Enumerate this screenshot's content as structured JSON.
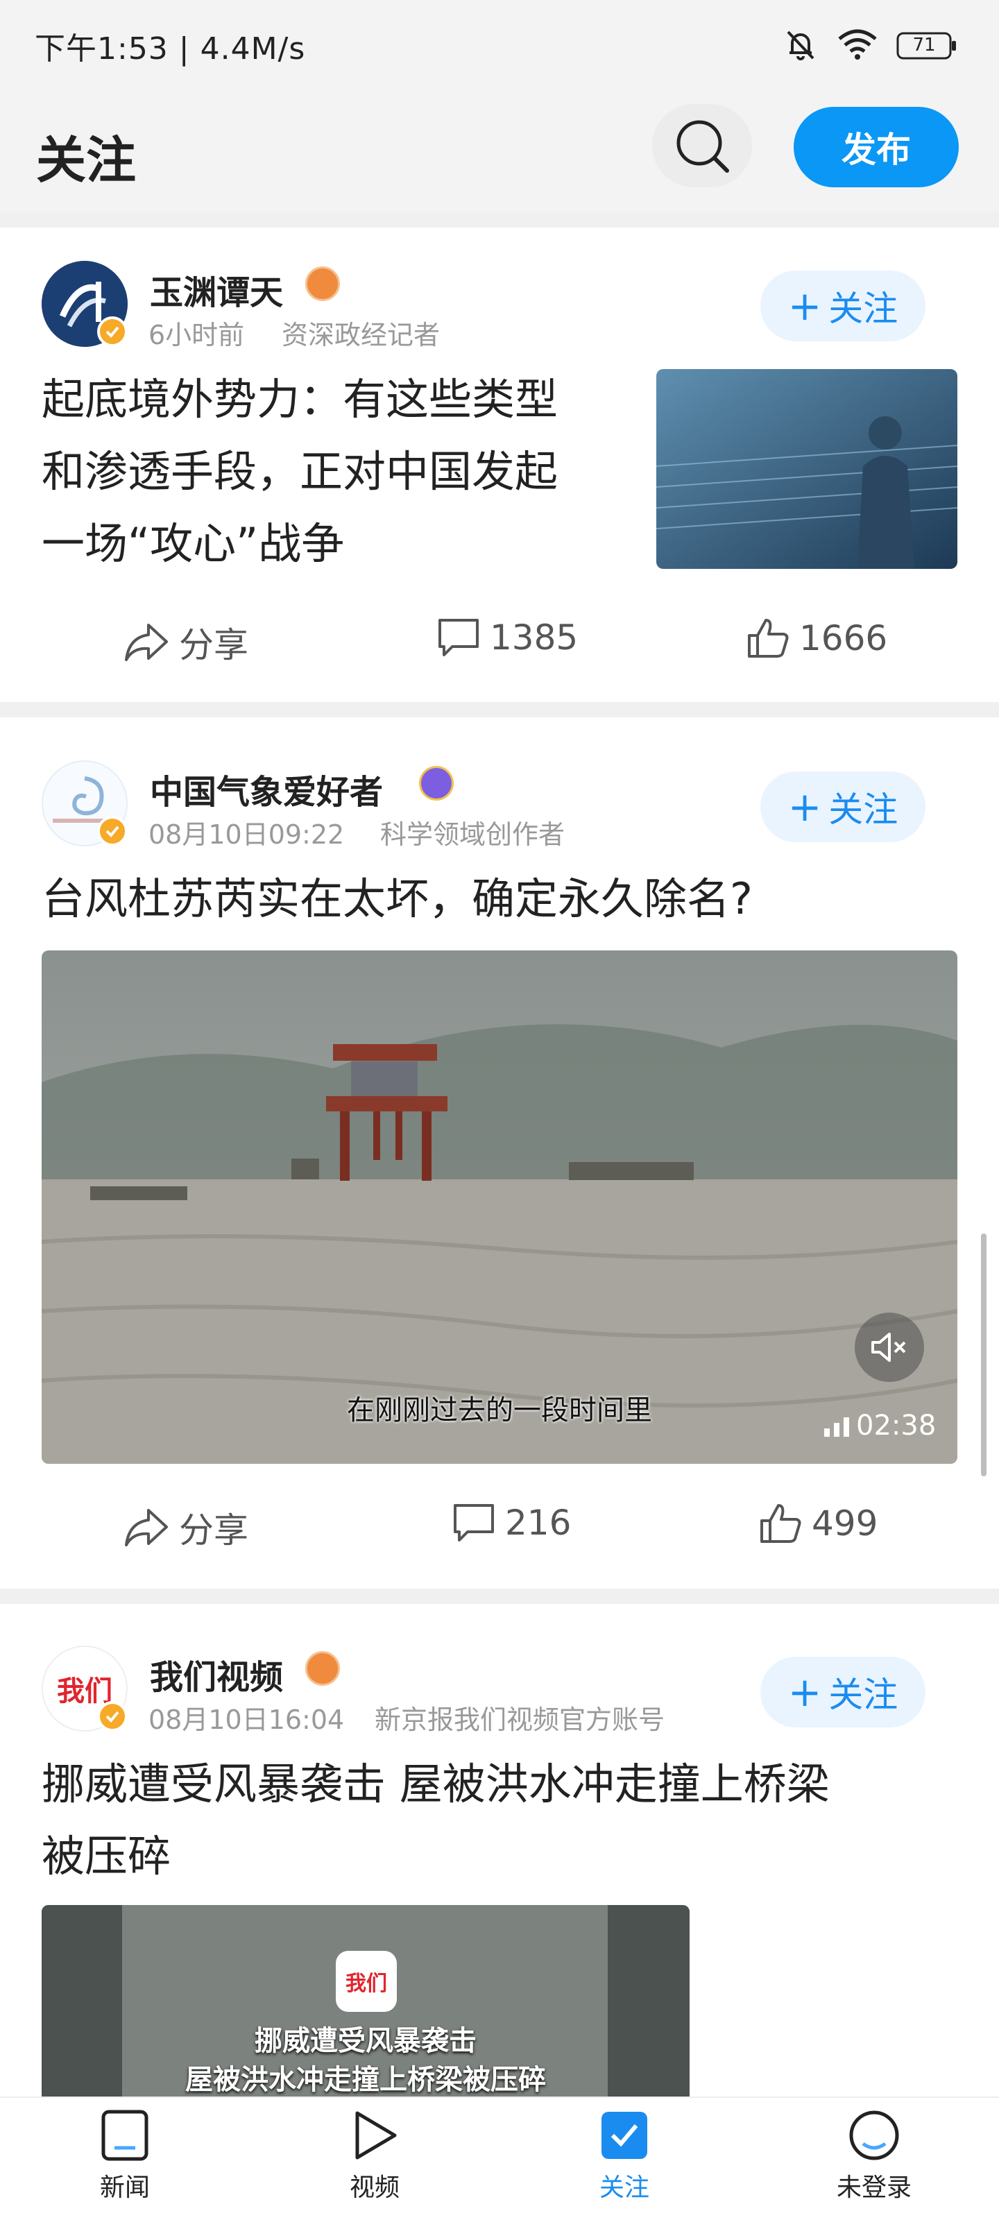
{
  "status_bar": {
    "time_speed": "下午1:53 | 4.4M/s",
    "battery": "71"
  },
  "header": {
    "title": "关注",
    "publish_label": "发布"
  },
  "posts": [
    {
      "author": "玉渊谭天",
      "time": "6小时前",
      "role": "资深政经记者",
      "follow_label": "关注",
      "title_lines": [
        "起底境外势力：有这些类型",
        "和渗透手段，正对中国发起",
        "一场“攻心”战争"
      ],
      "share_label": "分享",
      "comments": "1385",
      "likes": "1666"
    },
    {
      "author": "中国气象爱好者",
      "time": "08月10日09:22",
      "role": "科学领域创作者",
      "follow_label": "关注",
      "title": "台风杜苏芮实在太坏，确定永久除名?",
      "video_caption": "在刚刚过去的一段时间里",
      "video_duration": "02:38",
      "share_label": "分享",
      "comments": "216",
      "likes": "499"
    },
    {
      "author": "我们视频",
      "time": "08月10日16:04",
      "role": "新京报我们视频官方账号",
      "follow_label": "关注",
      "title_lines": [
        "挪威遭受风暴袭击 屋被洪水冲走撞上桥梁",
        "被压碎"
      ],
      "video_logo": "我们",
      "video_title_lines": [
        "挪威遭受风暴袭击",
        "屋被洪水冲走撞上桥梁被压碎"
      ]
    }
  ],
  "tabs": [
    {
      "label": "新闻"
    },
    {
      "label": "视频"
    },
    {
      "label": "关注"
    },
    {
      "label": "未登录"
    }
  ],
  "colors": {
    "accent": "#0a97f5",
    "follow_text": "#1a8cf0",
    "active_tab": "#1a8cf0"
  }
}
